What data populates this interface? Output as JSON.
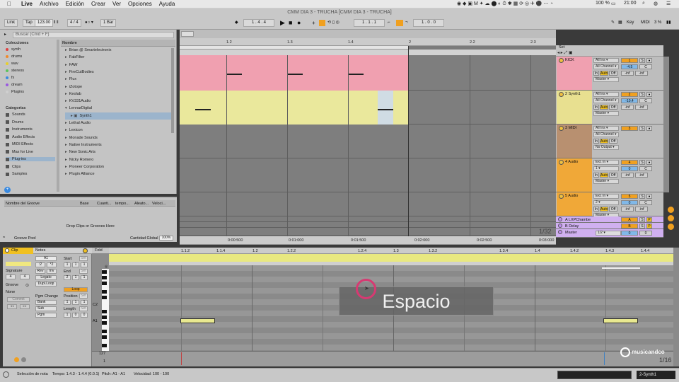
{
  "menubar": {
    "app": "Live",
    "items": [
      "Archivo",
      "Edición",
      "Crear",
      "Ver",
      "Opciones",
      "Ayuda"
    ],
    "battery": "100 %",
    "time": "21:00"
  },
  "window": {
    "title": "CMM DIA 3 - TRUCHA  [CMM DIA 3 - TRUCHA]"
  },
  "control": {
    "link": "Link",
    "tap": "Tap",
    "tempo": "123.00",
    "signature": "4 / 4",
    "quantize": "1 Bar",
    "position": "1 .  4 .  4",
    "loop_start": "1 .  1 .  1",
    "loop_length": "1 .  0 .  0",
    "key": "Key",
    "midi": "MIDI",
    "cpu": "3 %"
  },
  "browser": {
    "search_placeholder": "Buscar (Cmd + F)",
    "collections_head": "Colecciones",
    "collections": [
      {
        "label": "synth",
        "color": "#e04040"
      },
      {
        "label": "drums",
        "color": "#f08a2a"
      },
      {
        "label": "wav",
        "color": "#e8d02a"
      },
      {
        "label": "stereos",
        "color": "#5cc45c"
      },
      {
        "label": "fx",
        "color": "#3a8ae0"
      },
      {
        "label": "dream",
        "color": "#9a5ae0"
      },
      {
        "label": "Plugins",
        "color": "#cfcfcf"
      }
    ],
    "categories_head": "Categorías",
    "categories": [
      "Sounds",
      "Drums",
      "Instruments",
      "Audio Effects",
      "MIDI Effects",
      "Max for Live",
      "Plug-ins",
      "Clips",
      "Samples"
    ],
    "name_head": "Nombre",
    "items": [
      "Brian @ Smartelectronix",
      "FabFilter",
      "FAW",
      "FireCutBodies",
      "Flux",
      "iZotope",
      "Keolab",
      "KV331Audio",
      "LennarDigital",
      "Synth1",
      "Lethal Audio",
      "Lexicon",
      "Monade Sounds",
      "Native Instruments",
      "New Sonic Arts",
      "Nicky Romero",
      "Pioneer Corporation",
      "Plugin Alliance"
    ]
  },
  "groove": {
    "cols": [
      "Nombre del Groove",
      "Base",
      "Cuanti...",
      "tempo...",
      "Aleato...",
      "Veloci..."
    ],
    "drop": "Drop Clips or Grooves Here",
    "global_label": "Cantidad Global",
    "global_value": "100%",
    "pool": "Groove Pool"
  },
  "arrangement": {
    "ruler": [
      "1.2",
      "1.3",
      "1.4",
      "2",
      "2.2",
      "2.3"
    ],
    "time_ruler": [
      "0:00:500",
      "0:01:000",
      "0:01:500",
      "0:02:000",
      "0:02:500",
      "0:03:000"
    ],
    "zoom": "1/32",
    "set_label": "Set"
  },
  "tracks": [
    {
      "name": "KICK",
      "color": "#f0a0b0",
      "input": "All Ins",
      "channel": "All Channel",
      "output": "Master",
      "num": "1",
      "vol": "-4.5",
      "pan": "C"
    },
    {
      "name": "2 Synth1",
      "color": "#e8e090",
      "input": "All Ins",
      "channel": "All Channel",
      "output": "Master",
      "num": "2",
      "vol": "-10.4",
      "pan": "C"
    },
    {
      "name": "3 MIDI",
      "color": "#b89070",
      "input": "All Ins",
      "channel": "All Channel",
      "output": "No Output",
      "num": "3",
      "vol": "",
      "pan": ""
    },
    {
      "name": "4 Audio",
      "color": "#f0a838",
      "input": "Ext. In",
      "channel": "1",
      "output": "Master",
      "num": "4",
      "vol": "0",
      "pan": "C"
    },
    {
      "name": "5 Audio",
      "color": "#f0a838",
      "input": "Ext. In",
      "channel": "2",
      "output": "Master",
      "num": "5",
      "vol": "0",
      "pan": "C"
    }
  ],
  "returns": [
    {
      "name": "A LXPChambe",
      "color": "#d0b0f0",
      "letter": "A"
    },
    {
      "name": "B Delay",
      "color": "#d0b0f0",
      "letter": "B"
    },
    {
      "name": "Master",
      "color": "#d0b0f0",
      "letter": ""
    }
  ],
  "master_io": "1/2",
  "mixer_labels": {
    "in": "In",
    "auto": "Auto",
    "off": "Off",
    "inf": "-inf"
  },
  "clip": {
    "head": "Clip",
    "notes_head": "Notes",
    "note_name": "A1",
    "start": "Start",
    "end": "End",
    "signature": "Signature",
    "sig_num": "4",
    "sig_den": "4",
    "groove": "Groove",
    "none": "None",
    "commit": "Commit",
    "rev": "Rev",
    "inv": "Inv",
    "legato": "Legato",
    "dupl": "Dupl.Loop",
    "loop": "Loop",
    "position": "Position",
    "length": "Length",
    "pgm": "Pgm Change",
    "bank": "Bank",
    "sub": "Sub",
    "pgm_short": "Pgm",
    "div2": ":2",
    "mul2": "*2",
    "set": "Set",
    "start_val": [
      "1",
      "1",
      "1"
    ],
    "end_val": [
      "2",
      "1",
      "1"
    ],
    "pos_val": [
      "1",
      "1",
      "1"
    ],
    "len_val": [
      "1",
      "0",
      "0"
    ]
  },
  "editor": {
    "fold": "Fold",
    "ruler": [
      "1.1.2",
      "1.1.4",
      "1.2",
      "1.2.2",
      "1.2.4",
      "1.3",
      "1.3.2",
      "1.3.4",
      "1.4",
      "1.4.2",
      "1.4.3",
      "1.4.4"
    ],
    "c2": "C2",
    "a1": "A1",
    "vel_top": "127",
    "vel_bot": "1",
    "zoom": "1/16"
  },
  "status": {
    "left": "Selección de nota",
    "tempo": "Tempo: 1.4.3 - 1.4.4 (0.0.1)",
    "pitch": "Pitch: A1 - A1",
    "velocity": "Velocidad: 100 - 100",
    "track": "2-Synth1"
  },
  "overlay": {
    "key_label": "Espacio"
  },
  "logo": {
    "text": "musicandco"
  }
}
